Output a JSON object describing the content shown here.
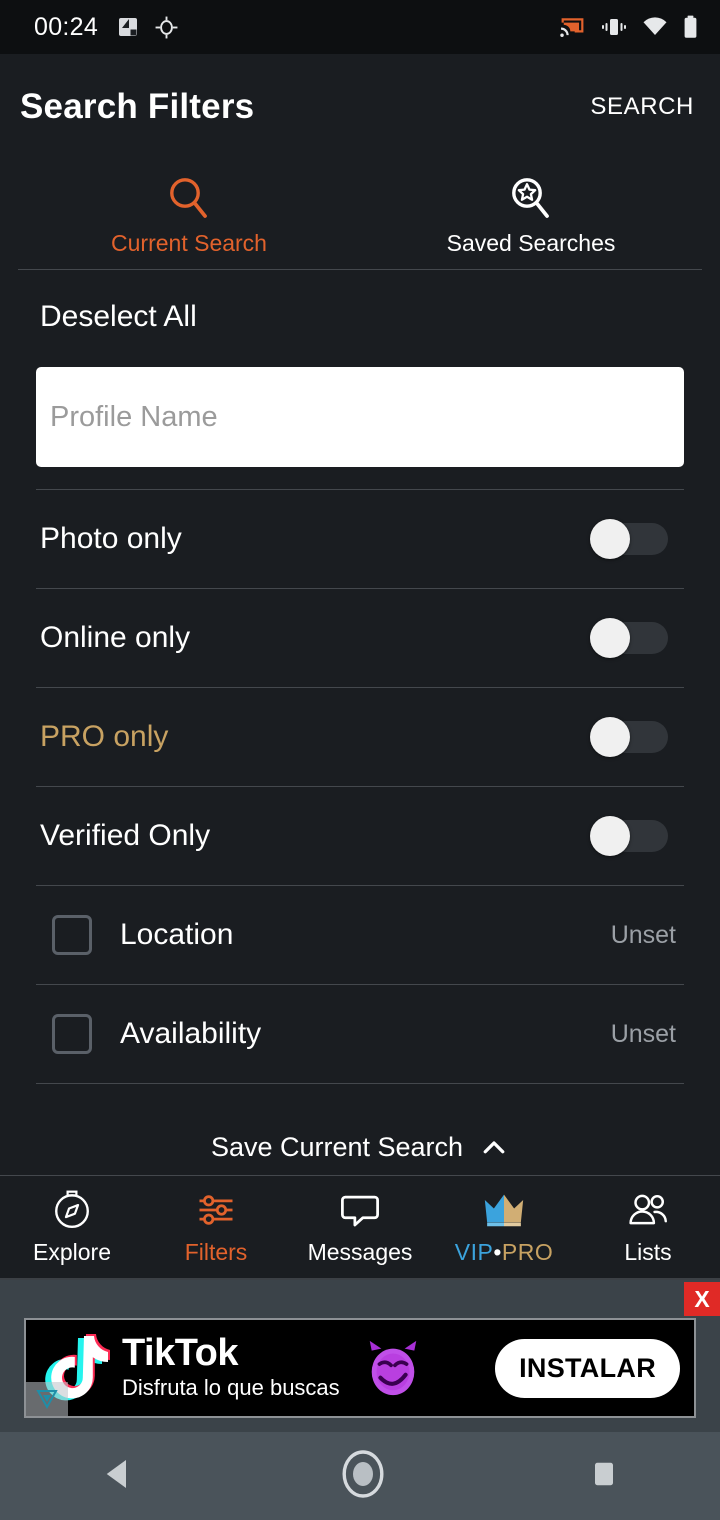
{
  "status_bar": {
    "time": "00:24",
    "left_icons": [
      "app-badge-icon",
      "gps-location-icon"
    ],
    "right_icons": [
      "cast-icon",
      "vibrate-icon",
      "wifi-icon",
      "battery-icon"
    ]
  },
  "header": {
    "title": "Search Filters",
    "action_label": "SEARCH"
  },
  "tabs": [
    {
      "label": "Current Search",
      "icon": "search-icon",
      "active": true
    },
    {
      "label": "Saved Searches",
      "icon": "saved-search-star-icon",
      "active": false
    }
  ],
  "filters": {
    "deselect_all_label": "Deselect All",
    "profile_name": {
      "value": "",
      "placeholder": "Profile Name"
    },
    "toggles": [
      {
        "label": "Photo only",
        "state": "off",
        "gold": false
      },
      {
        "label": "Online only",
        "state": "off",
        "gold": false
      },
      {
        "label": "PRO only",
        "state": "off",
        "gold": true
      },
      {
        "label": "Verified Only",
        "state": "off",
        "gold": false
      }
    ],
    "checkboxes": [
      {
        "label": "Location",
        "value": "Unset",
        "checked": false
      },
      {
        "label": "Availability",
        "value": "Unset",
        "checked": false
      }
    ]
  },
  "save_bar": {
    "label": "Save Current Search",
    "icon": "chevron-up-icon"
  },
  "bottom_nav": [
    {
      "label": "Explore",
      "icon": "compass-icon",
      "active": false
    },
    {
      "label": "Filters",
      "icon": "sliders-icon",
      "active": true
    },
    {
      "label": "Messages",
      "icon": "chat-bubble-icon",
      "active": false
    },
    {
      "label": "VIP",
      "label_separator": "•",
      "label_secondary": "PRO",
      "icon": "crown-icon",
      "active": false
    },
    {
      "label": "Lists",
      "icon": "people-icon",
      "active": false
    }
  ],
  "ad": {
    "close_label": "X",
    "brand": "TikTok",
    "tagline": "Disfruta lo que buscas",
    "cta_label": "INSTALAR",
    "emoji": "purple-devil-emoji",
    "adchoices": "adchoices-icon"
  },
  "system_nav": {
    "back": "back-triangle-icon",
    "home": "home-circle-icon",
    "recents": "recents-square-icon"
  },
  "colors": {
    "background": "#1a1d21",
    "status_bar_bg": "#0d0f11",
    "accent_orange": "#e2622c",
    "gold": "#c8a262",
    "vip_blue": "#3ba3dd",
    "divider": "#44484d",
    "muted_text": "#9ba0a6",
    "ad_close_red": "#e02a26",
    "sysnav_bg": "#4a535a"
  }
}
